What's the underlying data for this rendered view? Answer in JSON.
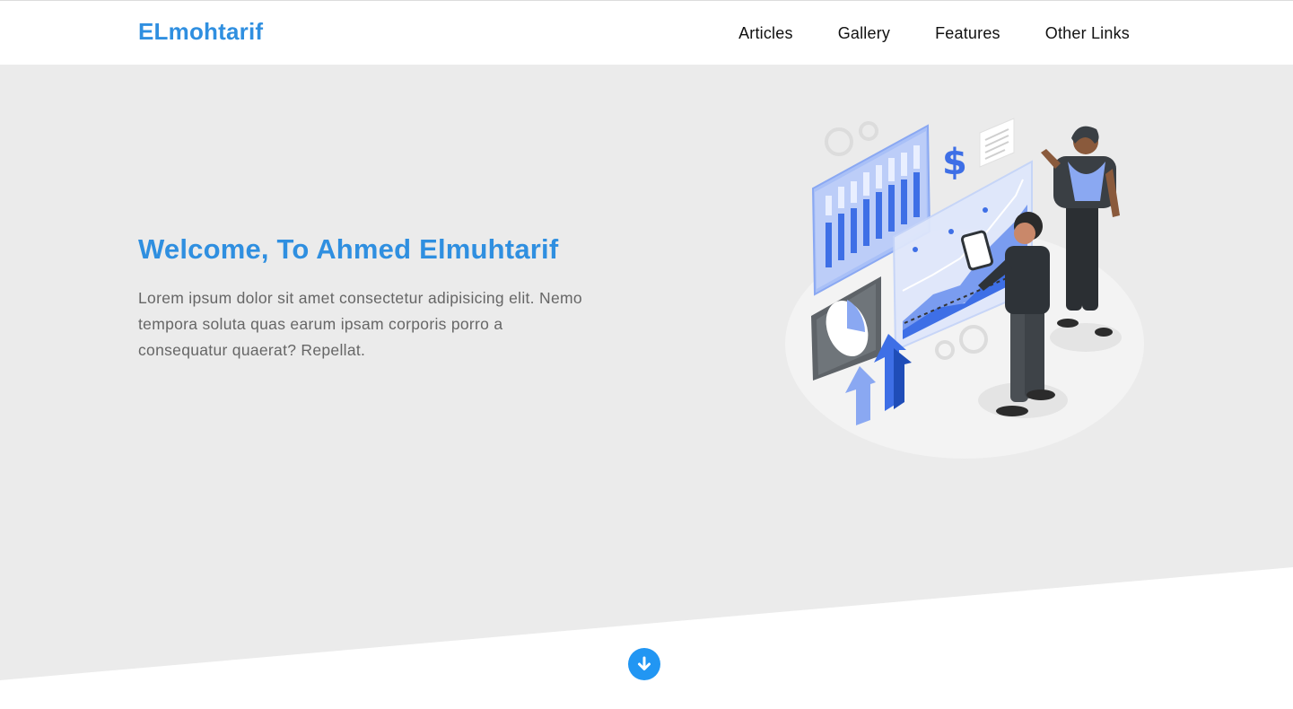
{
  "header": {
    "logo": "ELmohtarif",
    "nav": [
      {
        "label": "Articles"
      },
      {
        "label": "Gallery"
      },
      {
        "label": "Features"
      },
      {
        "label": "Other Links"
      }
    ]
  },
  "hero": {
    "title": "Welcome, To Ahmed Elmuhtarif",
    "text": "Lorem ipsum dolor sit amet consectetur adipisicing elit. Nemo tempora soluta quas earum ipsam corporis porro a consequatur quaerat? Repellat.",
    "illustration": "business-analytics-illustration",
    "go_down_icon": "arrow-down-circle-icon"
  },
  "colors": {
    "accent": "#2f8fe0",
    "hero_background": "#ebebeb",
    "down_button": "#2196f3"
  }
}
